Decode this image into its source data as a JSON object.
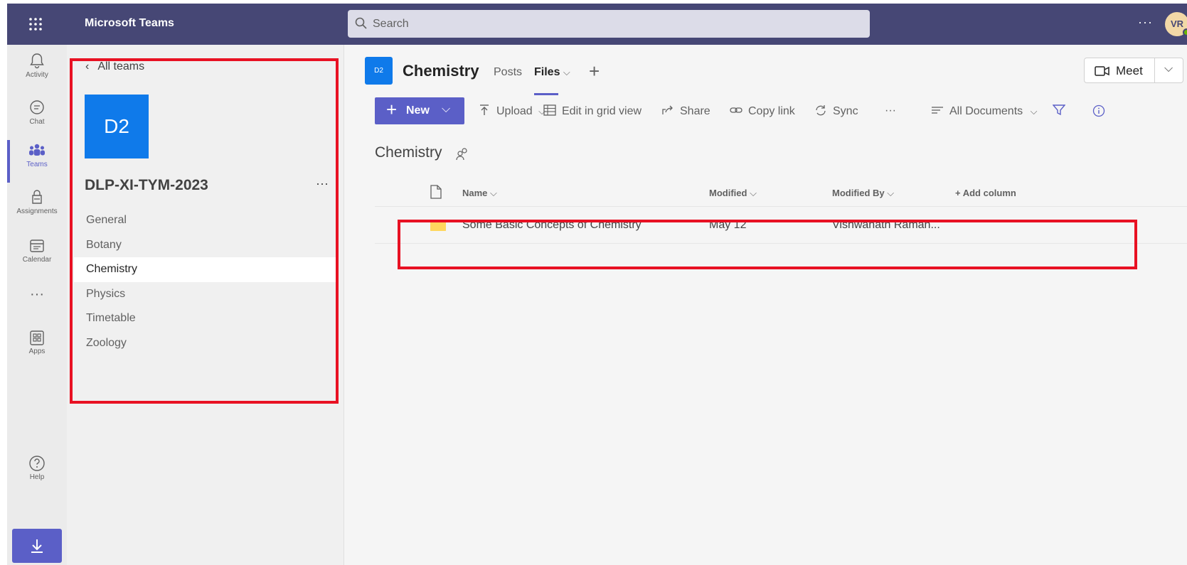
{
  "app": {
    "title": "Microsoft Teams"
  },
  "search": {
    "placeholder": "Search"
  },
  "user": {
    "initials": "VR"
  },
  "rail": {
    "items": [
      {
        "label": "Activity",
        "icon": "bell-icon"
      },
      {
        "label": "Chat",
        "icon": "chat-icon"
      },
      {
        "label": "Teams",
        "icon": "teams-icon"
      },
      {
        "label": "Assignments",
        "icon": "assignments-icon"
      },
      {
        "label": "Calendar",
        "icon": "calendar-icon"
      },
      {
        "label": "Apps",
        "icon": "apps-icon"
      },
      {
        "label": "Help",
        "icon": "help-icon"
      }
    ]
  },
  "teampane": {
    "back_label": "All teams",
    "team_tile": "D2",
    "team_name": "DLP-XI-TYM-2023",
    "more": "···",
    "channels": [
      "General",
      "Botany",
      "Chemistry",
      "Physics",
      "Timetable",
      "Zoology"
    ]
  },
  "header": {
    "tile": "D2",
    "title": "Chemistry",
    "tabs": [
      "Posts",
      "Files"
    ],
    "meet_label": "Meet"
  },
  "commands": {
    "new": "New",
    "upload": "Upload",
    "edit_grid": "Edit in grid view",
    "share": "Share",
    "copy_link": "Copy link",
    "sync": "Sync",
    "more": "···",
    "view": "All Documents"
  },
  "library": {
    "title": "Chemistry",
    "columns": {
      "name": "Name",
      "modified": "Modified",
      "modified_by": "Modified By",
      "add_column": "+ Add column"
    },
    "rows": [
      {
        "name": "Some Basic Concepts of Chemistry",
        "modified": "May 12",
        "modified_by": "Vishwanath Raman..."
      }
    ]
  },
  "colors": {
    "brand": "#464775",
    "accent": "#5b5fc7",
    "tile": "#0f7aea",
    "highlight": "#e81123",
    "folder": "#ffc83d"
  }
}
